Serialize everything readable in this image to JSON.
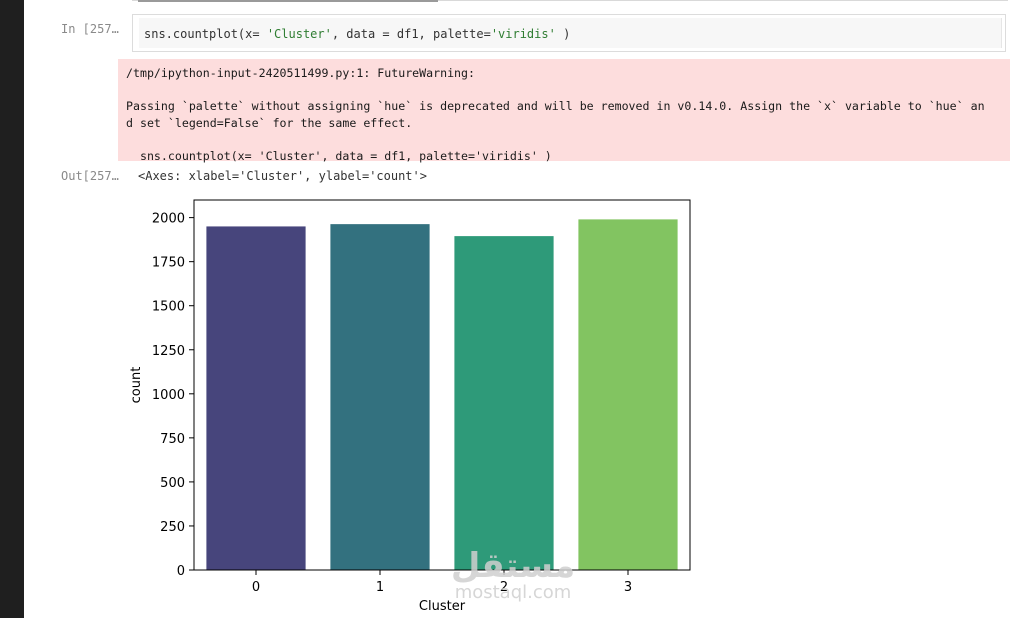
{
  "notebook": {
    "in_prompt": "In [257…",
    "out_prompt": "Out[257…",
    "code_line": {
      "prefix": "sns.countplot(x= ",
      "arg_x": "'Cluster'",
      "middle": ", data = df1, palette=",
      "arg_palette": "'viridis'",
      "suffix": " )"
    },
    "warning": {
      "line1": "/tmp/ipython-input-2420511499.py:1: FutureWarning:",
      "line2": "Passing `palette` without assigning `hue` is deprecated and will be removed in v0.14.0. Assign the `x` variable to `hue` an",
      "line3": "d set `legend=False` for the same effect.",
      "line4": "  sns.countplot(x= 'Cluster', data = df1, palette='viridis' )"
    },
    "output_repr": "<Axes: xlabel='Cluster', ylabel='count'>"
  },
  "chart_data": {
    "type": "bar",
    "categories": [
      "0",
      "1",
      "2",
      "3"
    ],
    "values": [
      1950,
      1963,
      1895,
      1990
    ],
    "colors": [
      "#47457c",
      "#33717f",
      "#2e9a79",
      "#82c461"
    ],
    "xlabel": "Cluster",
    "ylabel": "count",
    "ylim": [
      0,
      2100
    ],
    "yticks": [
      0,
      250,
      500,
      750,
      1000,
      1250,
      1500,
      1750,
      2000
    ],
    "grid": false,
    "legend": "none"
  },
  "watermark": {
    "arabic": "مستقل",
    "latin": "mostaql.com"
  }
}
